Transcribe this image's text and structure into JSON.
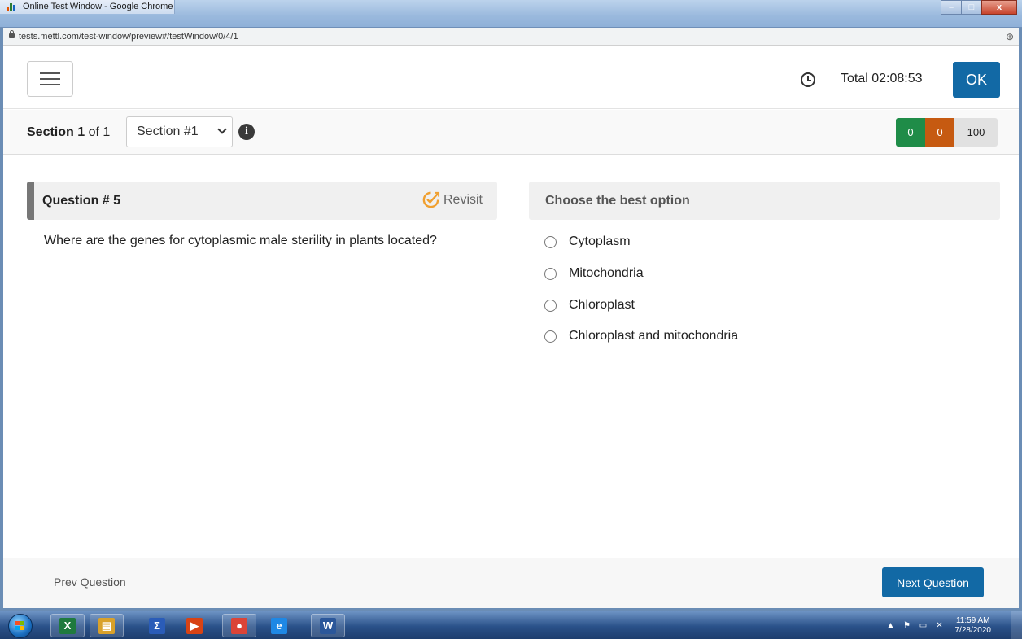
{
  "window": {
    "title": "Online Test Window - Google Chrome",
    "minimize": "–",
    "maximize": "□",
    "close": "x"
  },
  "address": {
    "url": "tests.mettl.com/test-window/preview#/testWindow/0/4/1",
    "zoom_icon": "⊕"
  },
  "topbar": {
    "timer_label": "Total 02:08:53",
    "ok_label": "OK"
  },
  "section": {
    "current_prefix": "Section 1",
    "of_text": " of 1",
    "selected": "Section #1",
    "info": "i"
  },
  "counters": {
    "answered": "0",
    "marked": "0",
    "total": "100"
  },
  "question": {
    "title": "Question # 5",
    "revisit_label": "Revisit",
    "text": "Where are the genes for cytoplasmic male sterility in plants located?"
  },
  "options": {
    "header": "Choose the best option",
    "items": [
      "Cytoplasm",
      "Mitochondria",
      "Chloroplast",
      "Chloroplast and mitochondria"
    ]
  },
  "footer": {
    "prev_label": "Prev Question",
    "next_label": "Next Question"
  },
  "taskbar": {
    "apps": [
      {
        "name": "excel",
        "glyph": "X",
        "color": "#1f7a3e"
      },
      {
        "name": "file-explorer",
        "glyph": "▤",
        "color": "#d9a12a"
      },
      {
        "name": "sigma-app",
        "glyph": "Σ",
        "color": "#2a5cb8"
      },
      {
        "name": "media-app",
        "glyph": "▶",
        "color": "#d84315"
      },
      {
        "name": "chrome",
        "glyph": "●",
        "color": "#db4437"
      },
      {
        "name": "internet-explorer",
        "glyph": "e",
        "color": "#1e88e5"
      },
      {
        "name": "word",
        "glyph": "W",
        "color": "#2b579a"
      }
    ],
    "time": "11:59 AM",
    "date": "7/28/2020"
  },
  "colors": {
    "primary": "#1269a5",
    "answered": "#1f8c48",
    "marked": "#c65a11",
    "revisit_icon": "#f0a030"
  }
}
